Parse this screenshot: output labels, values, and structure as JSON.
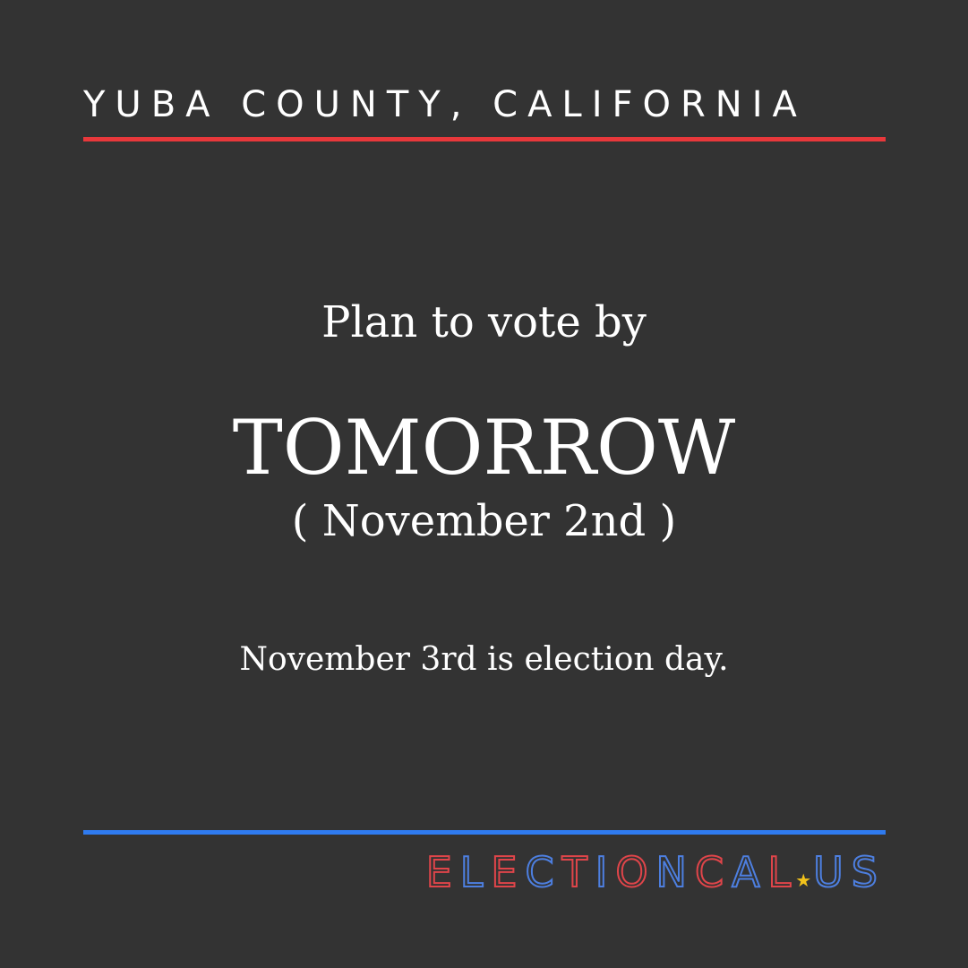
{
  "header": {
    "location": "YUBA COUNTY, CALIFORNIA"
  },
  "message": {
    "lead": "Plan to vote by",
    "deadline": "TOMORROW",
    "deadline_date": "( November 2nd )",
    "note": "November 3rd is election day."
  },
  "brand": {
    "name": "ELECTIONCAL",
    "separator_icon": "star-icon",
    "tld": "US"
  },
  "colors": {
    "background": "#333333",
    "top_rule": "#e8383b",
    "bottom_rule": "#2f7bf0",
    "brand_red": "#e0454a",
    "brand_blue": "#4d7fe0",
    "star": "#f2c21b"
  }
}
